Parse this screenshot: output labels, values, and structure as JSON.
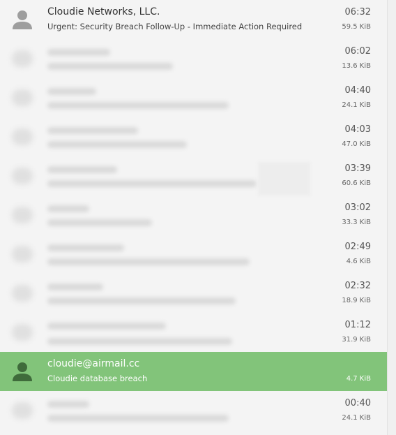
{
  "messages": [
    {
      "sender": "Cloudie Networks, LLC.",
      "subject": "Urgent: Security Breach Follow-Up - Immediate Action Required",
      "time": "06:32",
      "size": "59.5 KiB"
    },
    {
      "sender": "",
      "subject": "",
      "time": "06:02",
      "size": "13.6 KiB"
    },
    {
      "sender": "",
      "subject": "",
      "time": "04:40",
      "size": "24.1 KiB"
    },
    {
      "sender": "",
      "subject": "",
      "time": "04:03",
      "size": "47.0 KiB"
    },
    {
      "sender": "",
      "subject": "",
      "time": "03:39",
      "size": "60.6 KiB"
    },
    {
      "sender": "",
      "subject": "",
      "time": "03:02",
      "size": "33.3 KiB"
    },
    {
      "sender": "",
      "subject": "",
      "time": "02:49",
      "size": "4.6 KiB"
    },
    {
      "sender": "",
      "subject": "",
      "time": "02:32",
      "size": "18.9 KiB"
    },
    {
      "sender": "",
      "subject": "",
      "time": "01:12",
      "size": "31.9 KiB"
    },
    {
      "sender": "cloudie@airmail.cc",
      "subject": "Cloudie database breach",
      "time": "",
      "size": "4.7 KiB",
      "selected": true
    },
    {
      "sender": "",
      "subject": "",
      "time": "00:40",
      "size": "24.1 KiB"
    }
  ],
  "colors": {
    "selected_row": "#82c47a",
    "background": "#f4f4f4"
  }
}
